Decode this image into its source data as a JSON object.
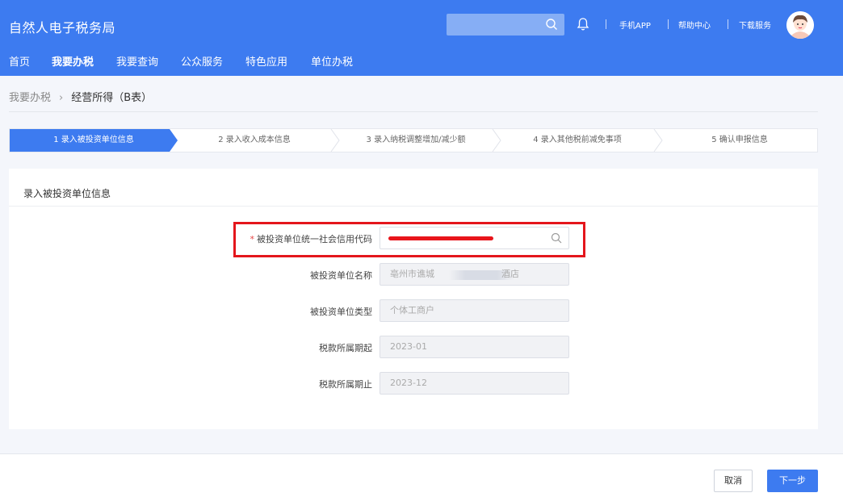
{
  "header": {
    "app_title": "自然人电子税务局",
    "links": [
      "手机APP",
      "帮助中心",
      "下载服务"
    ]
  },
  "nav": {
    "items": [
      "首页",
      "我要办税",
      "我要查询",
      "公众服务",
      "特色应用",
      "单位办税"
    ],
    "active": "我要办税"
  },
  "breadcrumb": {
    "parent": "我要办税",
    "separator": "›",
    "current": "经营所得（B表）"
  },
  "steps": [
    {
      "label": "1  录入被投资单位信息",
      "active": true
    },
    {
      "label": "2  录入收入成本信息",
      "active": false
    },
    {
      "label": "3  录入纳税调整增加/减少额",
      "active": false
    },
    {
      "label": "4  录入其他税前减免事项",
      "active": false
    },
    {
      "label": "5  确认申报信息",
      "active": false
    }
  ],
  "panel": {
    "title": "录入被投资单位信息",
    "fields": [
      {
        "label": "被投资单位统一社会信用代码",
        "value": "",
        "required": true,
        "editable": true
      },
      {
        "label": "被投资单位名称",
        "value": "亳州市谯城",
        "suffix": "酒店",
        "required": false,
        "editable": false
      },
      {
        "label": "被投资单位类型",
        "value": "个体工商户",
        "required": false,
        "editable": false
      },
      {
        "label": "税款所属期起",
        "value": "2023-01",
        "required": false,
        "editable": false
      },
      {
        "label": "税款所属期止",
        "value": "2023-12",
        "required": false,
        "editable": false
      }
    ]
  },
  "buttons": {
    "cancel": "取消",
    "next": "下一步"
  },
  "colors": {
    "brand": "#3d7bf0",
    "highlight": "#e4161c"
  }
}
